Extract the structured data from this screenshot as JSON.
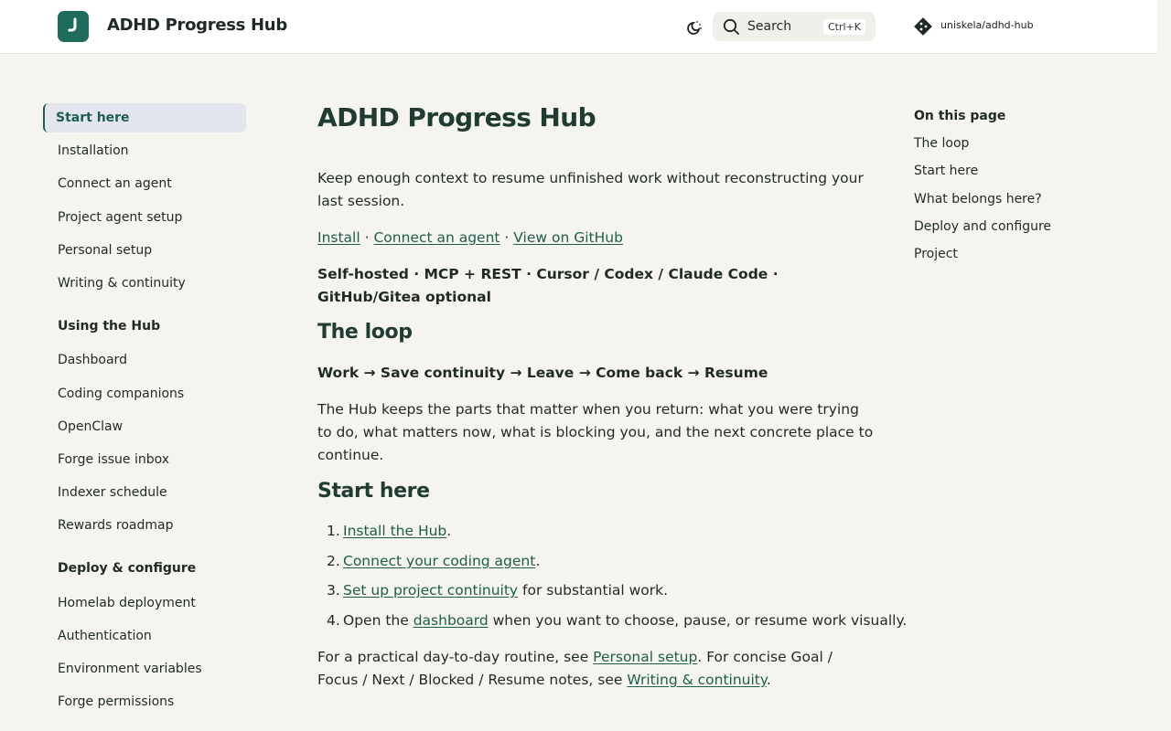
{
  "header": {
    "site_title": "ADHD Progress Hub",
    "search_label": "Search",
    "search_shortcut": "Ctrl+K",
    "repo_label": "uniskela/adhd-hub",
    "brand_color": "#1d6b5a"
  },
  "sidebar": {
    "start_items": [
      "Start here",
      "Installation",
      "Connect an agent",
      "Project agent setup",
      "Personal setup",
      "Writing & continuity"
    ],
    "group_using": "Using the Hub",
    "using_items": [
      "Dashboard",
      "Coding companions",
      "OpenClaw",
      "Forge issue inbox",
      "Indexer schedule",
      "Rewards roadmap"
    ],
    "group_deploy": "Deploy & configure",
    "deploy_items": [
      "Homelab deployment",
      "Authentication",
      "Environment variables",
      "Forge permissions"
    ]
  },
  "main": {
    "title": "ADHD Progress Hub",
    "intro": "Keep enough context to resume unfinished work without reconstructing your last session.",
    "links": {
      "install": "Install",
      "sep": " · ",
      "connect": "Connect an agent",
      "github": "View on GitHub"
    },
    "tagline": "Self-hosted · MCP + REST · Cursor / Codex / Claude Code · GitHub/Gitea optional",
    "loop_heading": "The loop",
    "loop_flow": "Work → Save continuity → Leave → Come back → Resume",
    "loop_text": "The Hub keeps the parts that matter when you return: what you were trying to do, what matters now, what is blocking you, and the next concrete place to continue.",
    "start_heading": "Start here",
    "steps": {
      "s1_link": "Install the Hub",
      "s1_rest": ".",
      "s2_link": "Connect your coding agent",
      "s2_rest": ".",
      "s3_link": "Set up project continuity",
      "s3_rest": " for substantial work.",
      "s4_pre": "Open the ",
      "s4_link": "dashboard",
      "s4_rest": " when you want to choose, pause, or resume work visually."
    },
    "routine": {
      "pre": "For a practical day-to-day routine, see ",
      "link1": "Personal setup",
      "mid": ". For concise Goal / Focus / Next / Blocked / Resume notes, see ",
      "link2": "Writing & continuity",
      "end": "."
    }
  },
  "toc": {
    "title": "On this page",
    "items": [
      "The loop",
      "Start here",
      "What belongs here?",
      "Deploy and configure",
      "Project"
    ]
  }
}
